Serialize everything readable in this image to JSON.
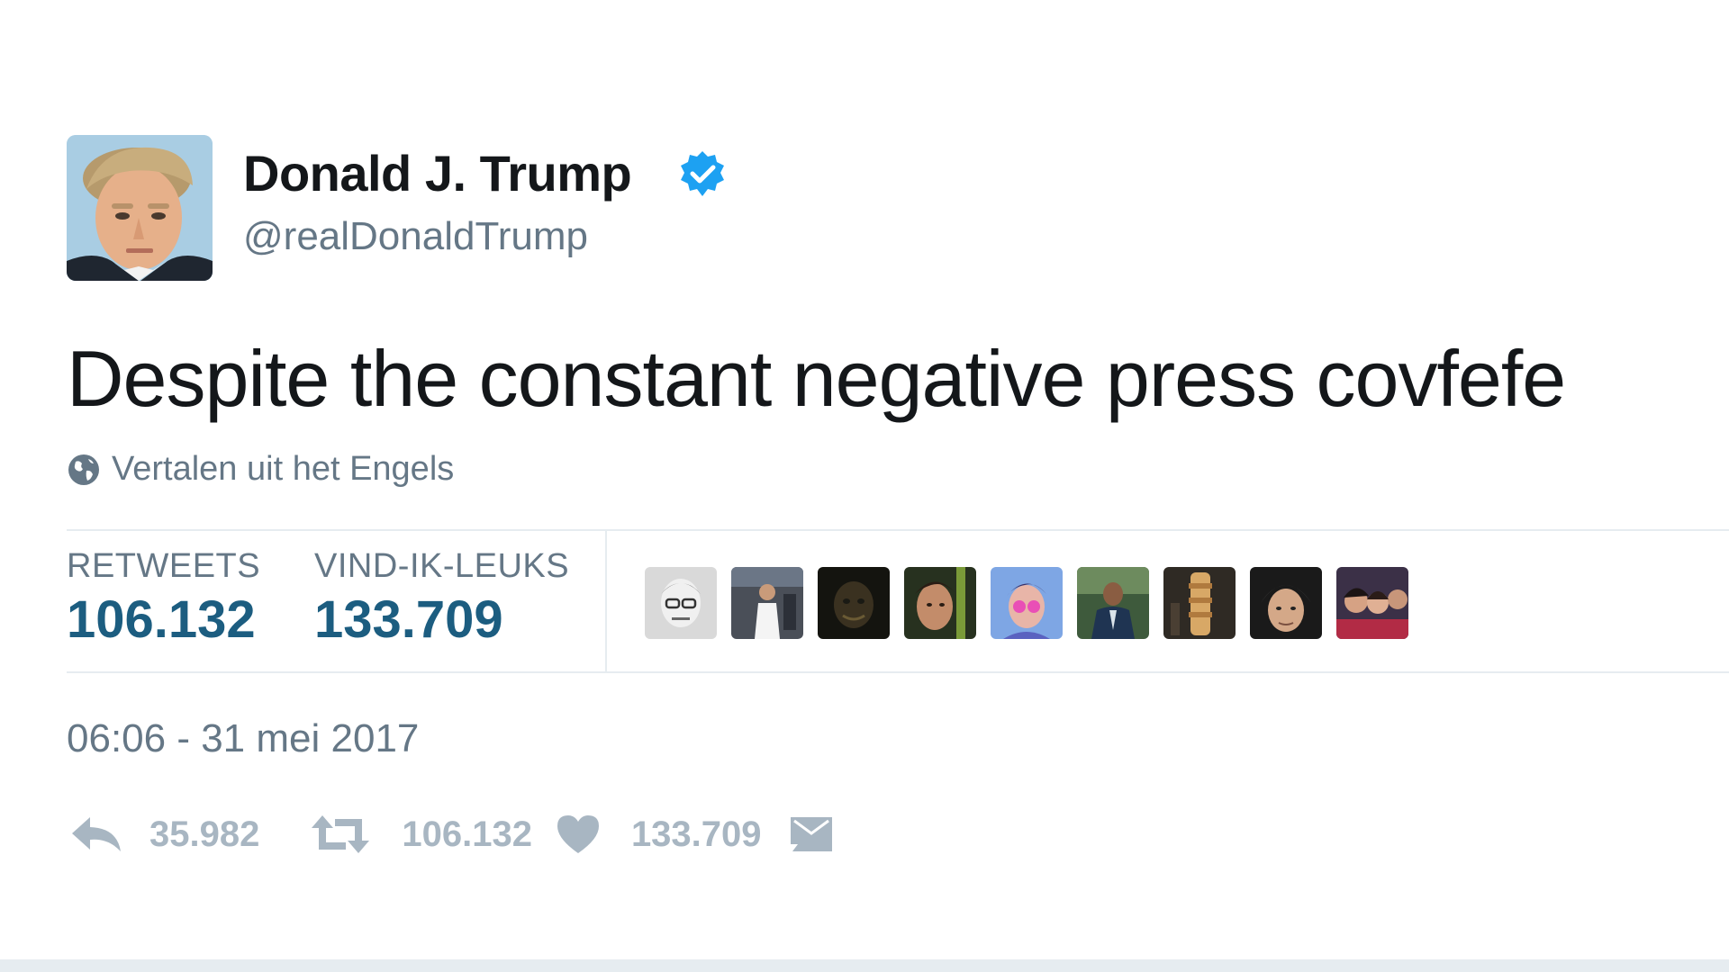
{
  "tweet": {
    "author": {
      "display_name": "Donald J. Trump",
      "handle": "@realDonaldTrump",
      "verified": true,
      "avatar_icon": "profile-photo"
    },
    "text": "Despite the constant negative press covfefe",
    "translate": {
      "icon": "globe-icon",
      "label": "Vertalen uit het Engels"
    },
    "stats": {
      "retweets_label": "RETWEETS",
      "retweets_value": "106.132",
      "likes_label": "VIND-IK-LEUKS",
      "likes_value": "133.709",
      "liker_avatar_count": 9
    },
    "timestamp": "06:06 - 31 mei 2017",
    "actions": {
      "reply_count": "35.982",
      "retweet_count": "106.132",
      "like_count": "133.709"
    }
  },
  "colors": {
    "text_primary": "#14171a",
    "text_secondary": "#657786",
    "stat_value": "#1c5d80",
    "action_gray": "#a8b6c2",
    "verified_blue": "#1da1f2",
    "divider": "#e6ecf0"
  }
}
